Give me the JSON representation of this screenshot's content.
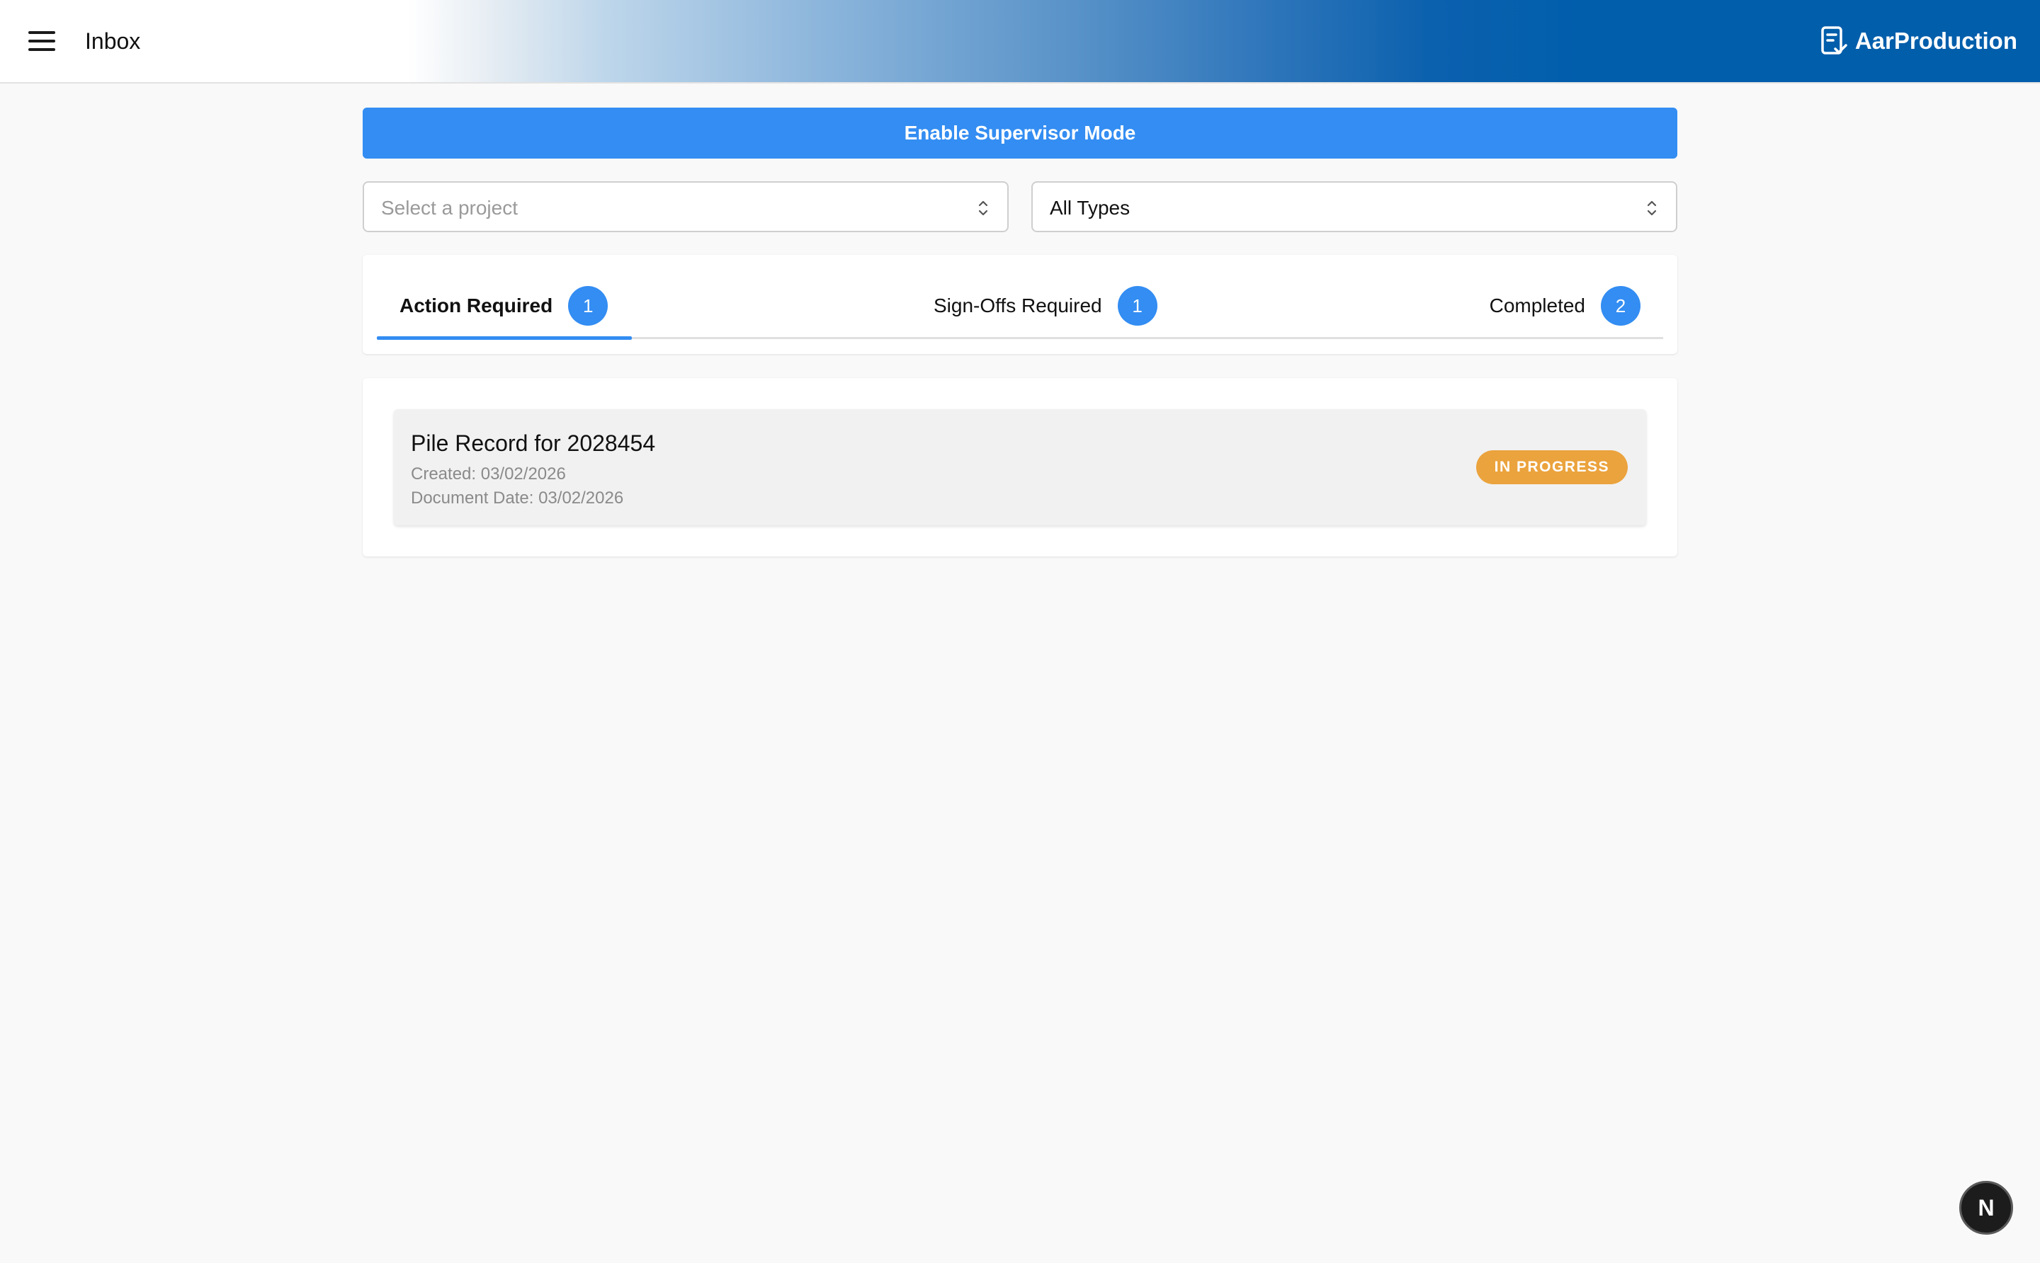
{
  "appbar": {
    "title": "Inbox",
    "brand": "AarProduction",
    "menu_icon": "hamburger-menu-icon",
    "brand_icon": "clipboard-check-icon"
  },
  "supervisor": {
    "label": "Enable Supervisor Mode"
  },
  "filters": {
    "project": {
      "placeholder": "Select a project",
      "value": ""
    },
    "type": {
      "value": "All Types"
    }
  },
  "tabs": [
    {
      "label": "Action Required",
      "count": "1",
      "active": true
    },
    {
      "label": "Sign-Offs Required",
      "count": "1",
      "active": false
    },
    {
      "label": "Completed",
      "count": "2",
      "active": false
    }
  ],
  "documents": [
    {
      "title": "Pile Record for 2028454",
      "created": "Created: 03/02/2026",
      "document_date": "Document Date: 03/02/2026",
      "status": "IN PROGRESS"
    }
  ],
  "fab": {
    "letter": "N"
  },
  "colors": {
    "primary": "#338df2",
    "brand_blue": "#005eab",
    "status_in_progress": "#eba33d"
  }
}
